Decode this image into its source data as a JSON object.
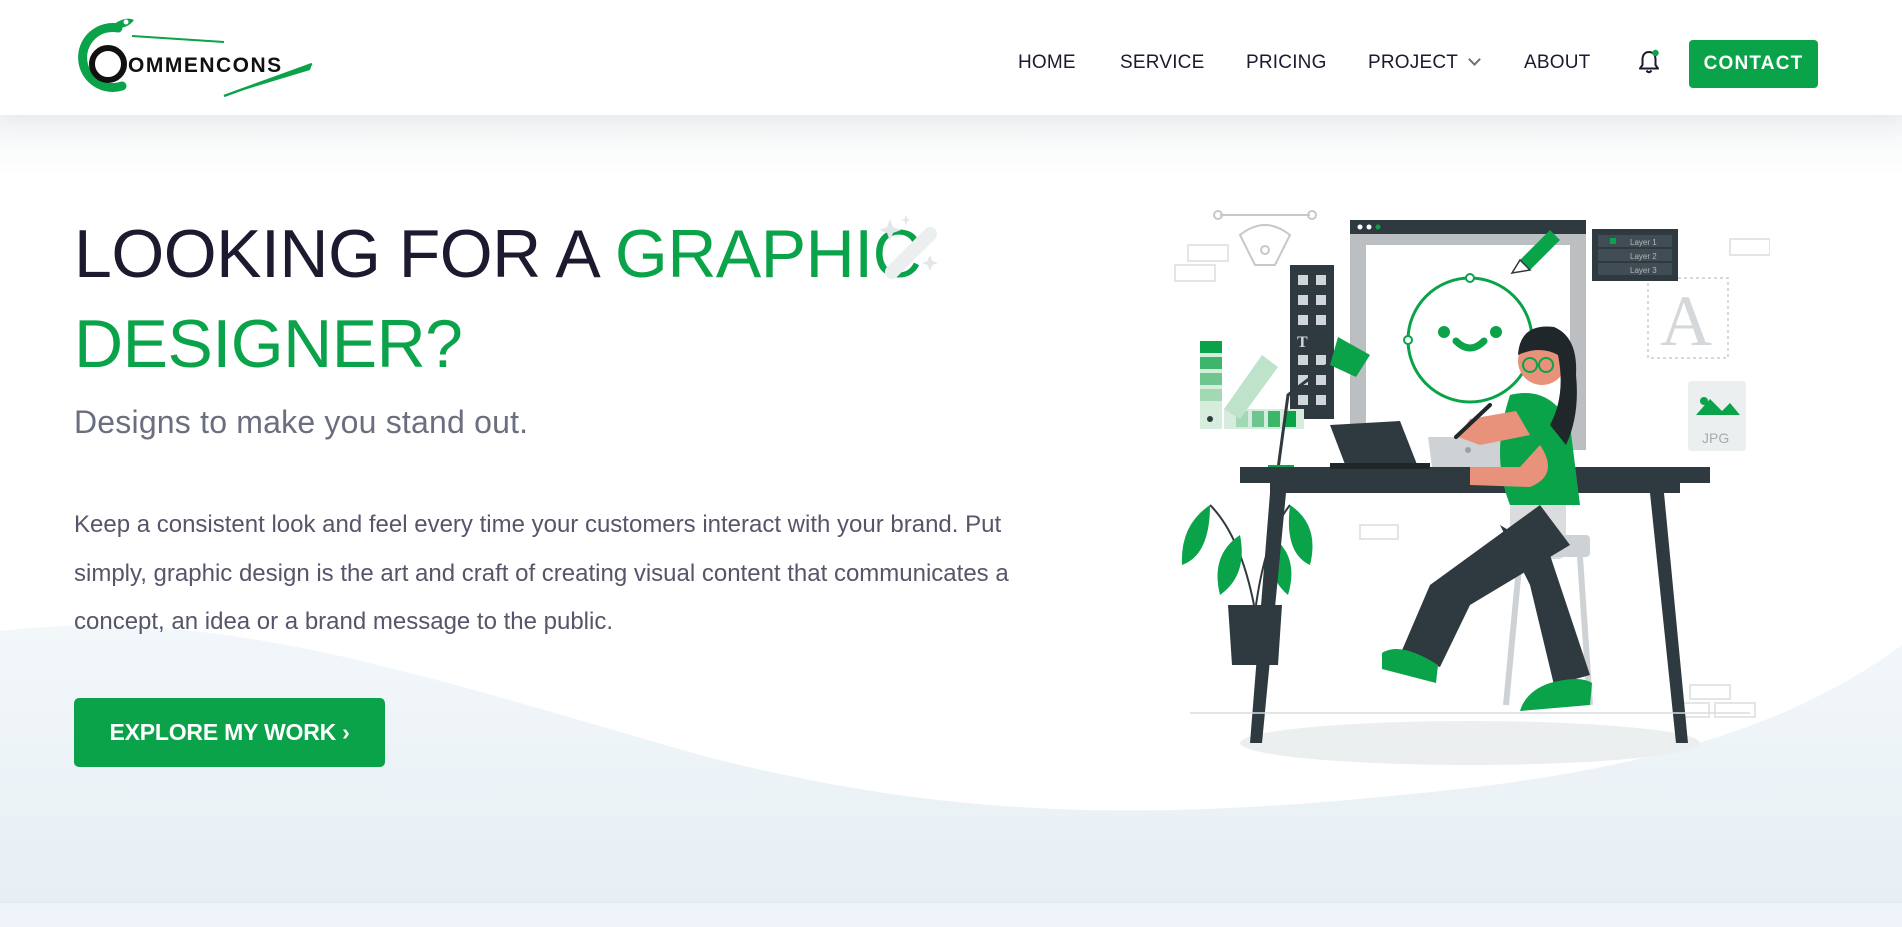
{
  "brand": {
    "logo_text": "OMMENCONS",
    "primary_color": "#0aa34a",
    "dark_color": "#1b1a2e"
  },
  "nav": {
    "items": [
      "HOME",
      "SERVICE",
      "PRICING",
      "PROJECT",
      "ABOUT"
    ],
    "project_has_dropdown": true,
    "notification_icon": "bell-icon",
    "contact_label": "CONTACT"
  },
  "hero": {
    "headline_part1": "LOOKING FOR A ",
    "headline_accent": "GRAPHIC DESIGNER?",
    "subtitle": "Designs to make you stand out.",
    "body": "Keep a consistent look and feel every time your customers interact with your brand. Put simply, graphic design is the art and craft of creating visual content that communicates a concept, an idea or a brand message to the public.",
    "cta_label": "EXPLORE MY WORK",
    "cta_icon": "chevron-right-icon",
    "decor_icon": "magic-wand-icon",
    "illustration": {
      "icon": "graphic-designer-illustration",
      "layer_labels": [
        "Layer 1",
        "Layer 2",
        "Layer 3"
      ],
      "file_badge": "JPG",
      "type_glyph": "A",
      "tool_glyph": "T"
    }
  }
}
